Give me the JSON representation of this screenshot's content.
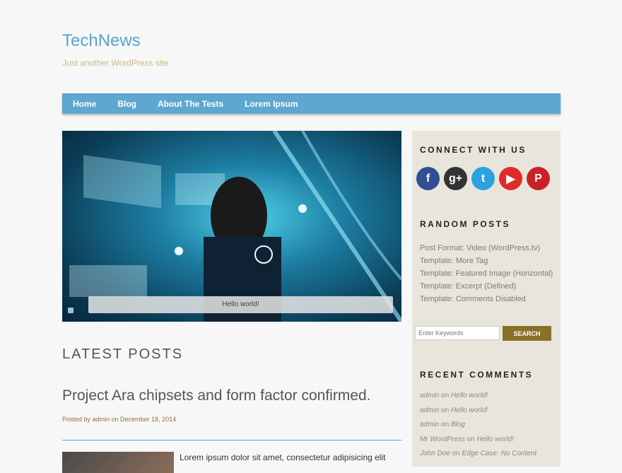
{
  "site": {
    "title": "TechNews",
    "tagline": "Just another WordPress site"
  },
  "nav": {
    "items": [
      "Home",
      "Blog",
      "About The Tests",
      "Lorem Ipsum"
    ]
  },
  "slider": {
    "caption": "Hello world!"
  },
  "main": {
    "section_title": "LATEST POSTS",
    "post": {
      "title": "Project Ara chipsets and form factor confirmed.",
      "meta": "Posted by admin on December 18, 2014",
      "excerpt": "Lorem ipsum dolor sit amet, consectetur adipisicing elit"
    }
  },
  "sidebar": {
    "connect_title": "CONNECT WITH US",
    "social": [
      "facebook-icon",
      "google-plus-icon",
      "twitter-icon",
      "youtube-icon",
      "pinterest-icon"
    ],
    "social_colors": [
      "#2f4e95",
      "#333333",
      "#2aa3df",
      "#e02a2a",
      "#cb2027"
    ],
    "random_title": "RANDOM POSTS",
    "random_posts": [
      "Post Format: Video (WordPress.tv)",
      "Template: More Tag",
      "Template: Featured Image (Horizontal)",
      "Template: Excerpt (Defined)",
      "Template: Comments Disabled"
    ],
    "search": {
      "placeholder": "Enter Keywords",
      "button": "SEARCH"
    },
    "comments_title": "RECENT COMMENTS",
    "comments": [
      {
        "author": "admin",
        "on": "on",
        "post": "Hello world!"
      },
      {
        "author": "admin",
        "on": "on",
        "post": "Hello world!"
      },
      {
        "author": "admin",
        "on": "on",
        "post": "Blog"
      },
      {
        "author": "Mr WordPress",
        "on": "on",
        "post": "Hello world!"
      },
      {
        "author": "John Doe",
        "on": "on",
        "post": "Edge Case: No Content"
      }
    ]
  },
  "colors": {
    "accent": "#5ea7d0",
    "button": "#8a7128",
    "sidebar_bg": "#e8e6dc"
  }
}
